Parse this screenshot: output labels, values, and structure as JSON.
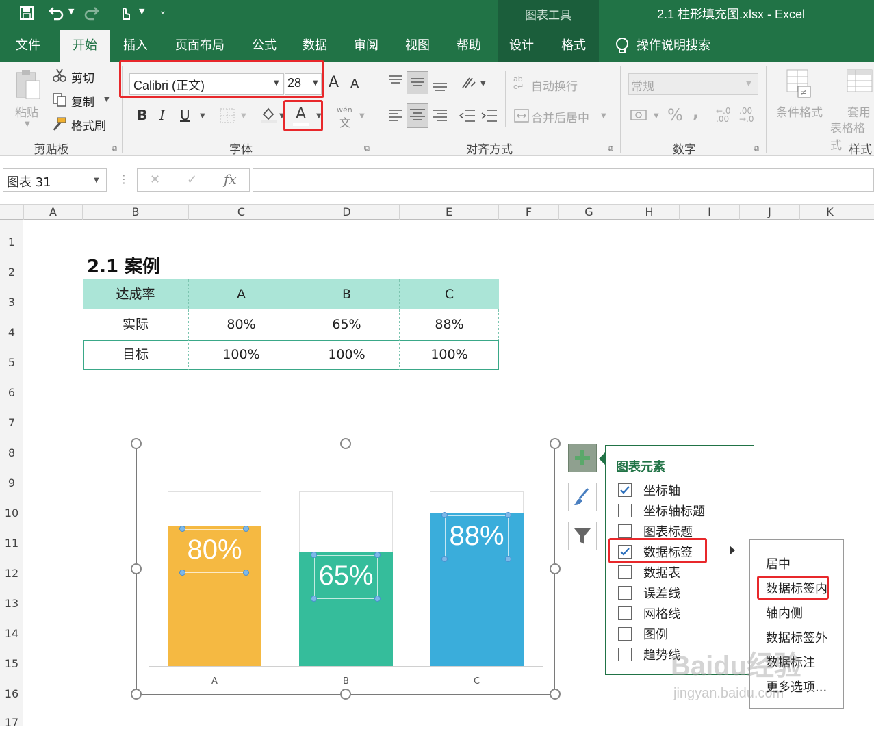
{
  "titlebar": {
    "chart_tools": "图表工具",
    "document_title": "2.1 柱形填充图.xlsx  -  Excel"
  },
  "tabs": [
    "文件",
    "开始",
    "插入",
    "页面布局",
    "公式",
    "数据",
    "审阅",
    "视图",
    "帮助",
    "设计",
    "格式"
  ],
  "tell_me": "操作说明搜索",
  "clipboard": {
    "paste": "粘贴",
    "cut": "剪切",
    "copy": "复制",
    "format_painter": "格式刷",
    "label": "剪贴板"
  },
  "font": {
    "name": "Calibri (正文)",
    "size": "28",
    "label": "字体",
    "bold": "B",
    "italic": "I",
    "underline": "U",
    "font_color": "A",
    "grow": "A",
    "shrink": "A",
    "phonetic": "wén"
  },
  "alignment": {
    "wrap": "自动换行",
    "merge": "合并后居中",
    "label": "对齐方式"
  },
  "number": {
    "format": "常规",
    "percent": "%",
    "comma": ",",
    "label": "数字"
  },
  "styles": {
    "conditional": "条件格式",
    "table_format_1": "套用",
    "table_format_2": "表格格式",
    "label": "样式"
  },
  "formula_bar": {
    "name_box": "图表 31",
    "cancel": "✕",
    "enter": "✓",
    "fx": "fx",
    "content": ""
  },
  "columns": [
    "A",
    "B",
    "C",
    "D",
    "E",
    "F",
    "G",
    "H",
    "I",
    "J",
    "K"
  ],
  "rows": [
    "1",
    "2",
    "3",
    "4",
    "5",
    "6",
    "7",
    "8",
    "9",
    "10",
    "11",
    "12",
    "13",
    "14",
    "15",
    "16",
    "17"
  ],
  "sheet": {
    "heading": "2.1 案例",
    "table": {
      "header": [
        "达成率",
        "A",
        "B",
        "C"
      ],
      "actual": [
        "实际",
        "80%",
        "65%",
        "88%"
      ],
      "target": [
        "目标",
        "100%",
        "100%",
        "100%"
      ]
    }
  },
  "chart_data": {
    "type": "bar",
    "categories": [
      "A",
      "B",
      "C"
    ],
    "series": [
      {
        "name": "目标",
        "values": [
          1.0,
          1.0,
          1.0
        ],
        "color": "#ffffff"
      },
      {
        "name": "实际",
        "values": [
          0.8,
          0.65,
          0.88
        ],
        "colors": [
          "#f5b942",
          "#35bd9b",
          "#3aaddb"
        ]
      }
    ],
    "data_labels": [
      "80%",
      "65%",
      "88%"
    ],
    "ylim": [
      0,
      1
    ]
  },
  "chart_elements": {
    "title": "图表元素",
    "items": [
      {
        "label": "坐标轴",
        "checked": true
      },
      {
        "label": "坐标轴标题",
        "checked": false
      },
      {
        "label": "图表标题",
        "checked": false
      },
      {
        "label": "数据标签",
        "checked": true
      },
      {
        "label": "数据表",
        "checked": false
      },
      {
        "label": "误差线",
        "checked": false
      },
      {
        "label": "网格线",
        "checked": false
      },
      {
        "label": "图例",
        "checked": false
      },
      {
        "label": "趋势线",
        "checked": false
      }
    ]
  },
  "data_label_submenu": [
    "居中",
    "数据标签内",
    "轴内侧",
    "数据标签外",
    "数据标注",
    "更多选项..."
  ],
  "watermark": {
    "line1": "Baidu经验",
    "line2": "jingyan.baidu.com"
  }
}
